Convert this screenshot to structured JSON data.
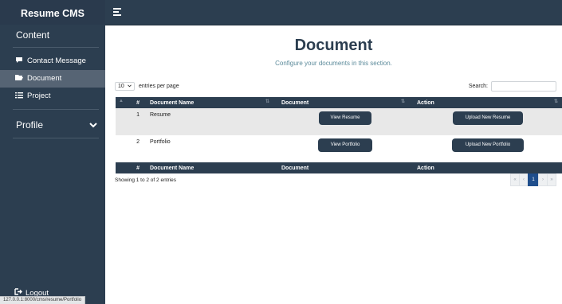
{
  "sidebar": {
    "brand": "Resume CMS",
    "content_title": "Content",
    "items": [
      {
        "label": "Contact Message",
        "icon": "comment-icon"
      },
      {
        "label": "Document",
        "icon": "folder-open-icon"
      },
      {
        "label": "Project",
        "icon": "list-icon"
      }
    ],
    "profile_title": "Profile",
    "logout_label": "Logout"
  },
  "status_url": "127.0.0.1:8000/cms/resume/Portfolio",
  "page": {
    "title": "Document",
    "subtitle": "Configure your documents in this section."
  },
  "controls": {
    "page_length": "10",
    "entries_label": "entries per page",
    "search_label": "Search:"
  },
  "table": {
    "headers": [
      "#",
      "Document Name",
      "Document",
      "Action"
    ],
    "rows": [
      {
        "num": "1",
        "name": "Resume",
        "view_label": "View Resume",
        "upload_label": "Upload New Resume"
      },
      {
        "num": "2",
        "name": "Portfolio",
        "view_label": "View Portfolio",
        "upload_label": "Upload New Portfolio"
      }
    ],
    "footer_headers": [
      "#",
      "Document Name",
      "Document",
      "Action"
    ]
  },
  "info": "Showing 1 to 2 of 2 entries",
  "pagination": {
    "first": "«",
    "prev": "‹",
    "current": "1",
    "next": "›",
    "last": "»"
  },
  "colors": {
    "sidebar": "#2c3e50",
    "accent": "#2c3e50",
    "pager_active": "#1f4e8c"
  }
}
